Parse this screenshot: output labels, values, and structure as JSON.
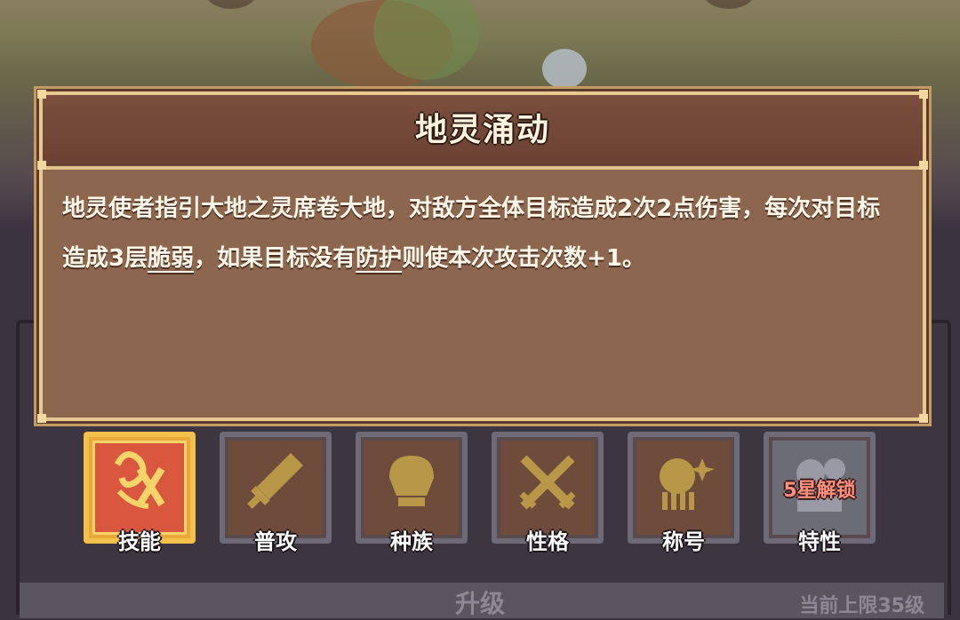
{
  "dialog": {
    "title": "地灵涌动",
    "description_parts": [
      "地灵使者指引大地之灵席卷大地，对敌方全体目标造成2次2点伤害，每次对目标造成3层",
      "脆弱",
      "，如果目标没有",
      "防护",
      "则使本次攻击次数+1。"
    ]
  },
  "tabs": [
    {
      "label": "技能",
      "icon": "skill-icon",
      "active": true
    },
    {
      "label": "普攻",
      "icon": "sword-icon",
      "active": false
    },
    {
      "label": "种族",
      "icon": "race-icon",
      "active": false
    },
    {
      "label": "性格",
      "icon": "crossed-swords-icon",
      "active": false
    },
    {
      "label": "称号",
      "icon": "title-icon",
      "active": false
    },
    {
      "label": "特性",
      "icon": "trait-icon",
      "active": false,
      "locked_text": "5星解锁"
    }
  ],
  "bottom": {
    "upgrade_label": "升级",
    "limit_label": "当前上限35级"
  },
  "colors": {
    "dialog_bg": "#8d6650",
    "dialog_border": "#e8c98f",
    "active_tab": "#e9a83a",
    "locked_text": "#ff8f7e"
  }
}
